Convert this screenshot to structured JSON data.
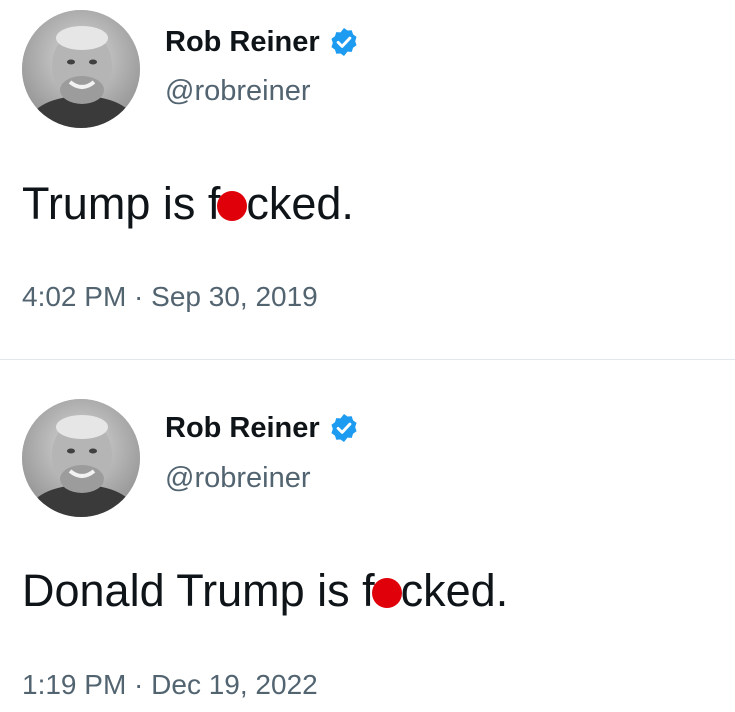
{
  "tweets": [
    {
      "author": {
        "display_name": "Rob Reiner",
        "handle": "@robreiner",
        "verified": true,
        "verified_icon": "verified-badge-icon"
      },
      "text_before": "Trump is f",
      "text_after": "cked.",
      "redaction": "red-dot",
      "timestamp": "4:02 PM · Sep 30, 2019"
    },
    {
      "author": {
        "display_name": "Rob Reiner",
        "handle": "@robreiner",
        "verified": true,
        "verified_icon": "verified-badge-icon"
      },
      "text_before": "Donald Trump is f",
      "text_after": "cked.",
      "redaction": "red-dot",
      "timestamp": "1:19 PM · Dec 19, 2022"
    }
  ],
  "colors": {
    "text_primary": "#0f1419",
    "text_secondary": "#536471",
    "verified_blue": "#1d9bf0",
    "redaction_red": "#e0000a",
    "divider": "#e1e8ed"
  }
}
